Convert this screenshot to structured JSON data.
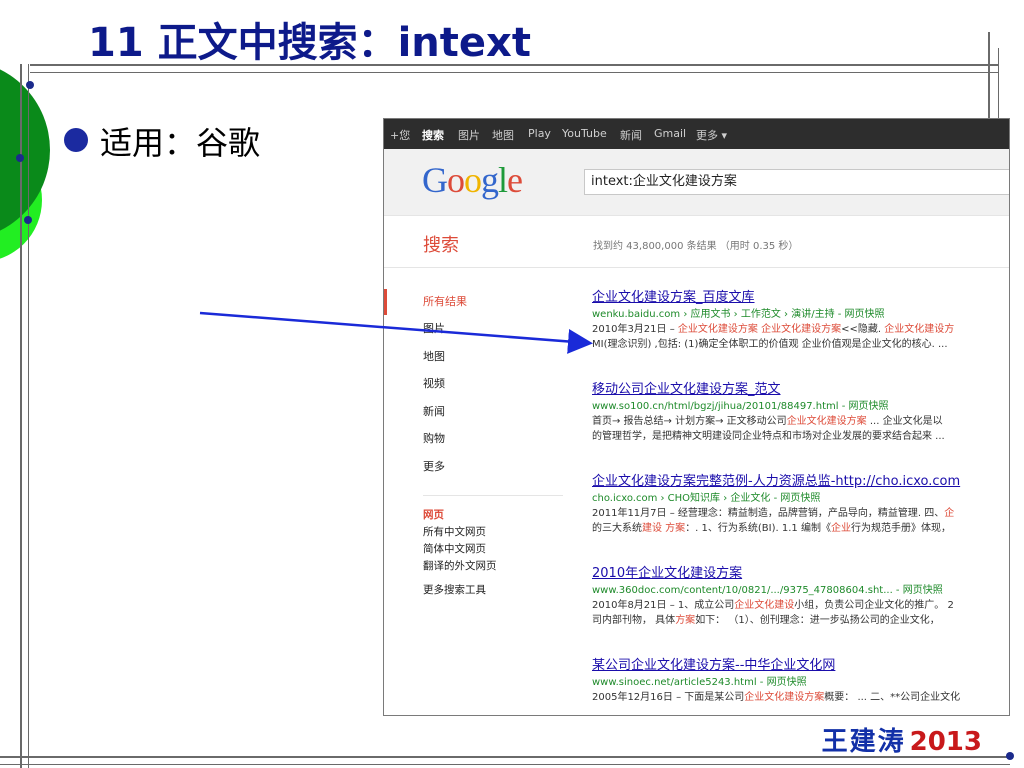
{
  "slide": {
    "title": "11 正文中搜索：intext",
    "bullet": "适用：谷歌",
    "signature_name": "王建涛",
    "signature_year": "2013"
  },
  "google": {
    "nav": [
      "+您",
      "搜索",
      "图片",
      "地图",
      "Play",
      "YouTube",
      "新闻",
      "Gmail",
      "更多 ▾"
    ],
    "logo": "Google",
    "query": "intext:企业文化建设方案",
    "search_label": "搜索",
    "result_stats": "找到约 43,800,000 条结果 （用时 0.35 秒）",
    "sidebar": [
      "所有结果",
      "图片",
      "地图",
      "视频",
      "新闻",
      "购物",
      "更多"
    ],
    "sidebar_sub": [
      "网页",
      "所有中文网页",
      "简体中文网页",
      "翻译的外文网页",
      "更多搜索工具"
    ],
    "results": [
      {
        "title": "企业文化建设方案_百度文库",
        "url": "wenku.baidu.com › 应用文书 › 工作范文 › 演讲/主持 - 网页快照",
        "s1_a": "2010年3月21日 – ",
        "s1_b": "企业文化建设方案 企业文化建设方案",
        "s1_c": "<<隐藏. ",
        "s1_d": "企业文化建设方",
        "s2_a": "MI(理念识别) ,包括: (1)确定全体职工的价值观 企业价值观是企业文化的核心. ..."
      },
      {
        "title": "移动公司企业文化建设方案_范文",
        "url": "www.so100.cn/html/bgzj/jihua/20101/88497.html - 网页快照",
        "s1_a": "首页→ 报告总结→ 计划方案→ 正文移动公司",
        "s1_b": "企业文化建设方案",
        "s1_c": " ... 企业文化是以",
        "s1_d": "",
        "s2_a": "的管理哲学，是把精神文明建设同企业特点和市场对企业发展的要求结合起来 ..."
      },
      {
        "title": "企业文化建设方案完整范例-人力资源总监-http://cho.icxo.com",
        "url": "cho.icxo.com › CHO知识库 › 企业文化 - 网页快照",
        "s1_a": "2011年11月7日 – 经营理念：精益制造，品牌营销，产品导向，精益管理. 四、",
        "s1_b": "企",
        "s1_c": "",
        "s1_d": "",
        "s2_a": "的三大系统",
        "s2_b": "建设 方案",
        "s2_c": "：. 1、行为系统(BI). 1.1 编制《",
        "s2_d": "企业",
        "s2_e": "行为规范手册》体现，"
      },
      {
        "title": "2010年企业文化建设方案",
        "url": "www.360doc.com/content/10/0821/.../9375_47808604.sht... - 网页快照",
        "s1_a": "2010年8月21日 – 1、成立公司",
        "s1_b": "企业文化建设",
        "s1_c": "小组，负责公司企业文化的推广。 2",
        "s1_d": "",
        "s2_a": "司内部刊物， 具体",
        "s2_b": "方案",
        "s2_c": "如下： （1）、创刊理念：进一步弘扬公司的企业文化，"
      },
      {
        "title": "某公司企业文化建设方案--中华企业文化网",
        "url": "www.sinoec.net/article5243.html - 网页快照",
        "s1_a": "2005年12月16日 – 下面是某公司",
        "s1_b": "企业文化建设方案",
        "s1_c": "概要： ... 二、**公司企业文化",
        "s1_d": ""
      }
    ]
  },
  "colors": {
    "title_blue": "#0d1a8a",
    "google_red": "#dd4b39",
    "link_blue": "#1a0dab",
    "url_green": "#1e8a2a",
    "arrow_blue": "#1a2ad8",
    "circle_dark_green": "#0a8a1a",
    "circle_light_green": "#22dd22"
  }
}
